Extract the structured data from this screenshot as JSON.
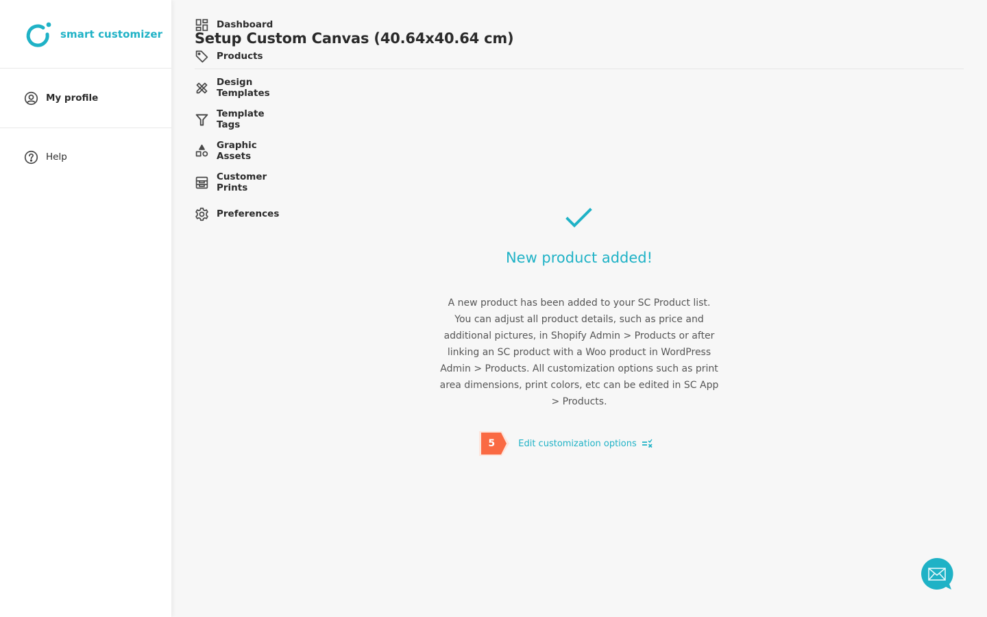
{
  "brand": {
    "name": "smart customizer",
    "accent_color": "#1fb2c6"
  },
  "sidebar": {
    "profile": {
      "label": "My profile",
      "icon": "user-circle-icon"
    },
    "items": [
      {
        "label": "Dashboard",
        "icon": "dashboard-icon"
      },
      {
        "label": "Products",
        "icon": "tag-icon"
      },
      {
        "label": "Design Templates",
        "icon": "design-tools-icon"
      },
      {
        "label": "Template Tags",
        "icon": "filter-icon"
      },
      {
        "label": "Graphic Assets",
        "icon": "shapes-icon"
      },
      {
        "label": "Customer Prints",
        "icon": "prints-icon"
      },
      {
        "label": "Preferences",
        "icon": "gear-icon"
      }
    ],
    "help": {
      "label": "Help",
      "icon": "help-circle-icon"
    }
  },
  "page": {
    "title": "Setup Custom Canvas (40.64x40.64 cm)"
  },
  "success": {
    "icon": "checkmark-icon",
    "title": "New product added!",
    "description": "A new product has been added to your SC Product list. You can adjust all product details, such as price and additional pictures, in Shopify Admin > Products or after linking an SC product with a Woo product in WordPress Admin > Products. All customization options such as print area dimensions, print colors, etc can be edited in SC App > Products.",
    "step_number": "5",
    "step_color": "#fa6a43",
    "action_label": "Edit customization options",
    "action_icon": "edit-options-icon"
  },
  "chat": {
    "icon": "mail-icon"
  }
}
